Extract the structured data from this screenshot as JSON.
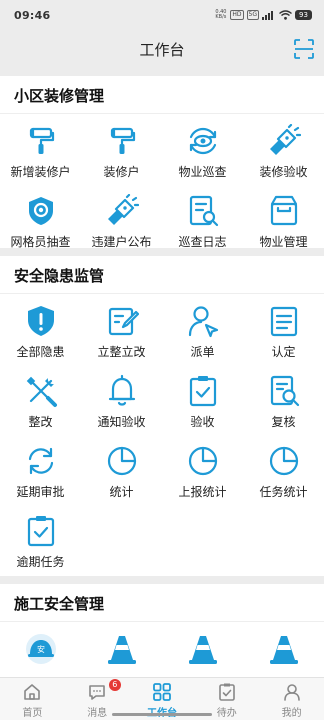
{
  "status_bar": {
    "time": "09:46",
    "net_speed_line1": "0.40",
    "net_speed_line2": "KB/s",
    "network_chip": "HD",
    "signal": "5G",
    "battery": "93"
  },
  "header": {
    "title": "工作台"
  },
  "sections": [
    {
      "title": "小区装修管理",
      "items": [
        {
          "label": "新增装修户",
          "icon": "paint-roller-icon"
        },
        {
          "label": "装修户",
          "icon": "paint-roller-icon"
        },
        {
          "label": "物业巡查",
          "icon": "eye-refresh-icon"
        },
        {
          "label": "装修验收",
          "icon": "flashlight-icon"
        },
        {
          "label": "网格员抽查",
          "icon": "target-shield-icon"
        },
        {
          "label": "违建户公布",
          "icon": "flashlight-icon"
        },
        {
          "label": "巡查日志",
          "icon": "log-search-icon"
        },
        {
          "label": "物业管理",
          "icon": "box-icon"
        }
      ]
    },
    {
      "title": "安全隐患监管",
      "items": [
        {
          "label": "全部隐患",
          "icon": "shield-alert-icon"
        },
        {
          "label": "立整立改",
          "icon": "edit-doc-icon"
        },
        {
          "label": "派单",
          "icon": "person-dispatch-icon"
        },
        {
          "label": "认定",
          "icon": "list-doc-icon"
        },
        {
          "label": "整改",
          "icon": "tools-icon"
        },
        {
          "label": "通知验收",
          "icon": "bell-icon"
        },
        {
          "label": "验收",
          "icon": "clipboard-check-icon"
        },
        {
          "label": "复核",
          "icon": "doc-search-icon"
        },
        {
          "label": "延期审批",
          "icon": "refresh-icon"
        },
        {
          "label": "统计",
          "icon": "pie-chart-icon"
        },
        {
          "label": "上报统计",
          "icon": "pie-chart-icon"
        },
        {
          "label": "任务统计",
          "icon": "pie-chart-icon"
        },
        {
          "label": "逾期任务",
          "icon": "clipboard-check-icon"
        }
      ]
    },
    {
      "title": "施工安全管理",
      "items": [
        {
          "label": "",
          "icon": "helmet-icon"
        },
        {
          "label": "",
          "icon": "traffic-cone-icon"
        },
        {
          "label": "",
          "icon": "traffic-cone-icon"
        },
        {
          "label": "",
          "icon": "traffic-cone-icon"
        }
      ]
    }
  ],
  "tabbar": {
    "tabs": [
      {
        "label": "首页",
        "icon": "home-icon",
        "active": false
      },
      {
        "label": "消息",
        "icon": "message-icon",
        "active": false,
        "badge": "6"
      },
      {
        "label": "工作台",
        "icon": "grid-icon",
        "active": true
      },
      {
        "label": "待办",
        "icon": "todo-icon",
        "active": false
      },
      {
        "label": "我的",
        "icon": "user-icon",
        "active": false
      }
    ]
  },
  "colors": {
    "accent": "#1e9ad6",
    "background": "#ececec",
    "badge": "#e53935"
  }
}
